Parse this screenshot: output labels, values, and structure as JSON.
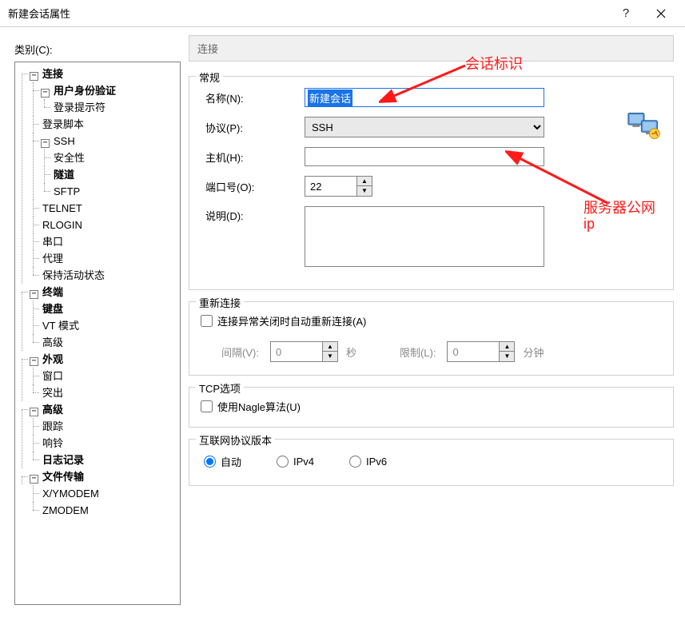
{
  "window": {
    "title": "新建会话属性",
    "help": "?",
    "close": "✕"
  },
  "categoryLabel": "类别(C):",
  "tree": {
    "connection": "连接",
    "auth": "用户身份验证",
    "loginPrompt": "登录提示符",
    "loginScript": "登录脚本",
    "ssh": "SSH",
    "security": "安全性",
    "tunnel": "隧道",
    "sftp": "SFTP",
    "telnet": "TELNET",
    "rlogin": "RLOGIN",
    "serial": "串口",
    "proxy": "代理",
    "keepalive": "保持活动状态",
    "terminal": "终端",
    "keyboard": "键盘",
    "vtmode": "VT 模式",
    "advancedTerm": "高级",
    "appearance": "外观",
    "windowAppear": "窗口",
    "highlight": "突出",
    "advanced": "高级",
    "trace": "跟踪",
    "bell": "响铃",
    "logging": "日志记录",
    "filetransfer": "文件传输",
    "xymodem": "X/YMODEM",
    "zmodem": "ZMODEM"
  },
  "headerStrip": "连接",
  "general": {
    "legend": "常规",
    "nameLabel": "名称(N):",
    "nameValue": "新建会话",
    "protocolLabel": "协议(P):",
    "protocolValue": "SSH",
    "hostLabel": "主机(H):",
    "hostValue": "",
    "portLabel": "端口号(O):",
    "portValue": "22",
    "descLabel": "说明(D):",
    "descValue": ""
  },
  "reconnect": {
    "legend": "重新连接",
    "checkboxLabel": "连接异常关闭时自动重新连接(A)",
    "intervalLabel": "间隔(V):",
    "intervalValue": "0",
    "intervalUnit": "秒",
    "limitLabel": "限制(L):",
    "limitValue": "0",
    "limitUnit": "分钟"
  },
  "tcp": {
    "legend": "TCP选项",
    "nagleLabel": "使用Nagle算法(U)"
  },
  "ipver": {
    "legend": "互联网协议版本",
    "auto": "自动",
    "ipv4": "IPv4",
    "ipv6": "IPv6"
  },
  "annotations": {
    "sessionLabel": "会话标识",
    "serverIp1": "服务器公网",
    "serverIp2": "ip"
  }
}
